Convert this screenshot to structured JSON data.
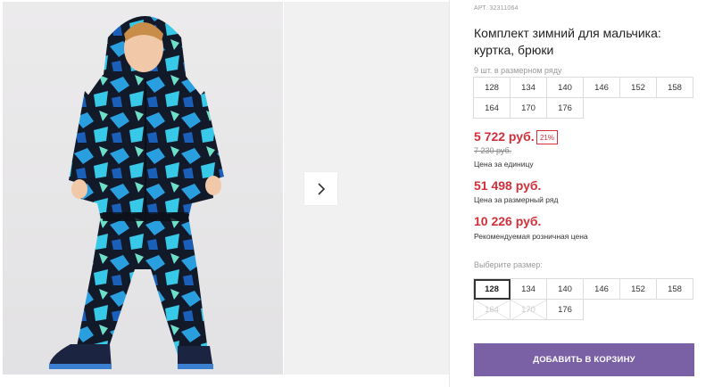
{
  "product": {
    "article": "АРТ. 32311064",
    "title": "Комплект зимний для мальчика: куртка, брюки",
    "image_alt": "boy in blue-black winter jacket and pants"
  },
  "pack_row": {
    "label": "9 шт. в размерном ряду",
    "sizes": [
      [
        "128",
        "134",
        "140",
        "146",
        "152",
        "158"
      ],
      [
        "164",
        "170",
        "176"
      ]
    ]
  },
  "pricing": {
    "unit_price": "5 722 руб.",
    "discount": "21%",
    "old_price": "7 230 руб.",
    "unit_caption": "Цена за единицу",
    "row_price": "51 498 руб.",
    "row_caption": "Цена за размерный ряд",
    "rrp": "10 226 руб.",
    "rrp_caption": "Рекомендуемая розничная цена"
  },
  "size_select": {
    "label": "Выберите размер:",
    "row1": [
      "128",
      "134",
      "140",
      "146",
      "152",
      "158"
    ],
    "row2": [
      "164",
      "170",
      "176"
    ],
    "selected": "128",
    "disabled": [
      "164",
      "170"
    ]
  },
  "cart_button": "ДОБАВИТЬ В КОРЗИНУ",
  "colors": {
    "accent": "#7a61a5",
    "price": "#d32f3b"
  },
  "icons": {
    "next": "chevron-right-icon"
  }
}
